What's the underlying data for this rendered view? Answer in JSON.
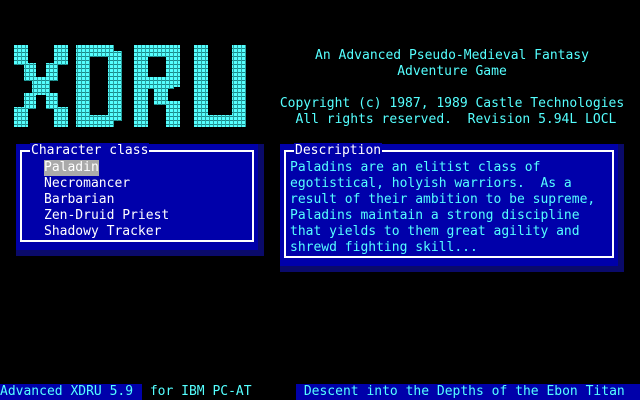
{
  "logo": {
    "text": "XDRU",
    "color": "#55ffff"
  },
  "header": {
    "tagline_1": "An Advanced Pseudo-Medieval Fantasy",
    "tagline_2": "Adventure Game",
    "copyright": "Copyright (c) 1987, 1989 Castle Technologies",
    "rights": " All rights reserved.  Revision 5.94L LOCL"
  },
  "character_panel": {
    "title": "Character class",
    "items": [
      {
        "label": "Paladin",
        "selected": true
      },
      {
        "label": "Necromancer",
        "selected": false
      },
      {
        "label": "Barbarian",
        "selected": false
      },
      {
        "label": "Zen-Druid Priest",
        "selected": false
      },
      {
        "label": "Shadowy Tracker",
        "selected": false
      }
    ]
  },
  "description_panel": {
    "title": "Description",
    "lines": [
      "Paladins are an elitist class of",
      "egotistical, holyish warriors.  As a",
      "result of their ambition to be supreme,",
      "Paladins maintain a strong discipline",
      "that yields to them great agility and",
      "shrewd fighting skill..."
    ]
  },
  "status_bar": {
    "product": "Advanced XDRU 5.9",
    "platform": " for IBM PC-AT",
    "subtitle": " Descent into the Depths of the Ebon Titan"
  },
  "colors": {
    "background": "#000000",
    "panel": "#0000aa",
    "cyan": "#55ffff",
    "white": "#ffffff",
    "highlight": "#aaaaaa"
  }
}
